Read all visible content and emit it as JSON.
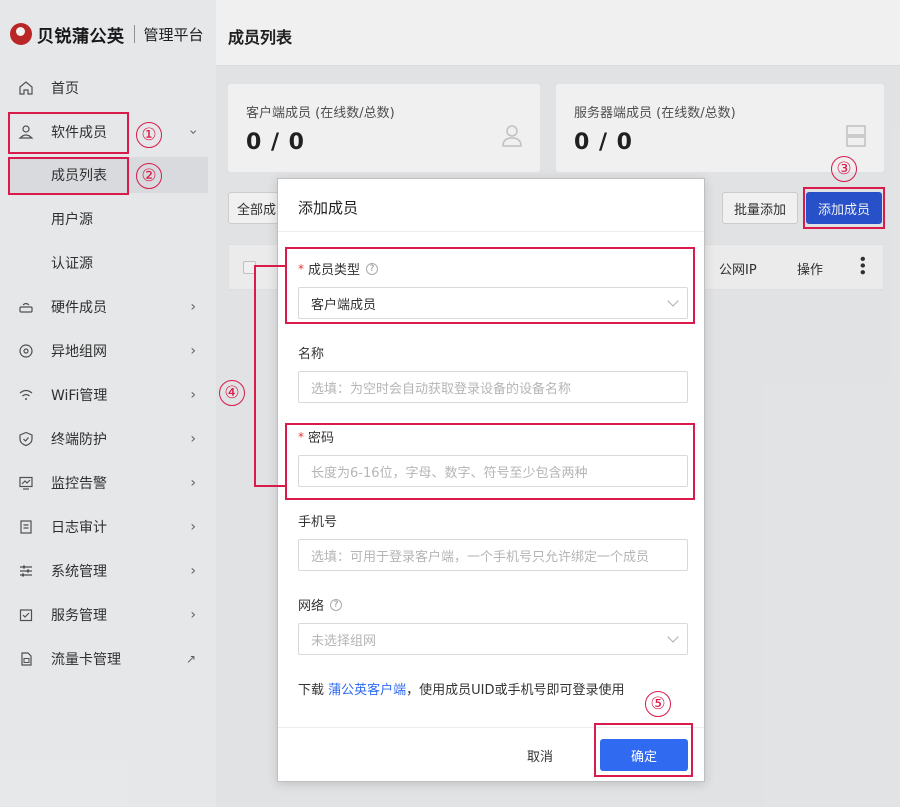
{
  "brand": {
    "name": "贝锐蒲公英",
    "subtitle": "管理平台"
  },
  "sidebar": {
    "items": [
      {
        "label": "首页",
        "icon": "home-icon"
      },
      {
        "label": "软件成员",
        "icon": "user-icon"
      },
      {
        "label": "成员列表"
      },
      {
        "label": "用户源"
      },
      {
        "label": "认证源"
      },
      {
        "label": "硬件成员",
        "icon": "router-icon"
      },
      {
        "label": "异地组网",
        "icon": "network-icon"
      },
      {
        "label": "WiFi管理",
        "icon": "wifi-icon"
      },
      {
        "label": "终端防护",
        "icon": "shield-icon"
      },
      {
        "label": "监控告警",
        "icon": "monitor-icon"
      },
      {
        "label": "日志审计",
        "icon": "log-icon"
      },
      {
        "label": "系统管理",
        "icon": "settings-icon"
      },
      {
        "label": "服务管理",
        "icon": "service-icon"
      },
      {
        "label": "流量卡管理",
        "icon": "sim-icon"
      }
    ]
  },
  "header": {
    "title": "成员列表"
  },
  "stats": {
    "client": {
      "caption": "客户端成员 (在线数/总数)",
      "value": "0 / 0"
    },
    "server": {
      "caption": "服务器端成员 (在线数/总数)",
      "value": "0 / 0"
    }
  },
  "toolbar": {
    "filter_label": "全部成",
    "batch_add": "批量添加",
    "add_member": "添加成员"
  },
  "table": {
    "col_ip": "公网IP",
    "col_action": "操作"
  },
  "modal": {
    "title": "添加成员",
    "type_label": "成员类型",
    "type_value": "客户端成员",
    "name_label": "名称",
    "name_placeholder": "选填：为空时会自动获取登录设备的设备名称",
    "password_label": "密码",
    "password_placeholder": "长度为6-16位，字母、数字、符号至少包含两种",
    "phone_label": "手机号",
    "phone_placeholder": "选填：可用于登录客户端，一个手机号只允许绑定一个成员",
    "network_label": "网络",
    "network_placeholder": "未选择组网",
    "note_prefix": "下载",
    "note_link": "蒲公英客户端",
    "note_suffix": "，使用成员UID或手机号即可登录使用",
    "cancel": "取消",
    "confirm": "确定"
  },
  "annotations": [
    "①",
    "②",
    "③",
    "④",
    "⑤"
  ],
  "colors": {
    "accent": "#2f6af0",
    "annotation": "#d81b4a"
  }
}
